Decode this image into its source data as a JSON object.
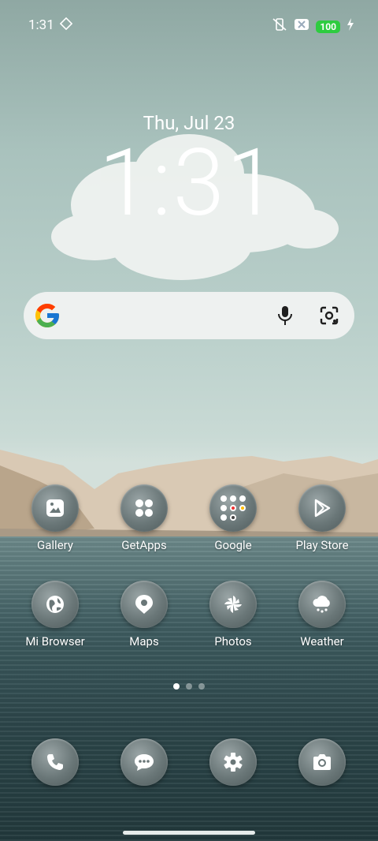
{
  "status_bar": {
    "time": "1:31",
    "battery": "100"
  },
  "lockscreen": {
    "date": "Thu, Jul 23",
    "clock": "1:31"
  },
  "search_bar": {
    "icons": [
      "google-logo",
      "microphone-icon",
      "lens-icon"
    ]
  },
  "apps": [
    {
      "label": "Gallery",
      "icon": "gallery-icon"
    },
    {
      "label": "GetApps",
      "icon": "getapps-icon"
    },
    {
      "label": "Google",
      "icon": "google-folder"
    },
    {
      "label": "Play Store",
      "icon": "play-store-icon"
    },
    {
      "label": "Mi Browser",
      "icon": "globe-icon"
    },
    {
      "label": "Maps",
      "icon": "maps-icon"
    },
    {
      "label": "Photos",
      "icon": "photos-icon"
    },
    {
      "label": "Weather",
      "icon": "weather-icon"
    }
  ],
  "dock": [
    {
      "icon": "phone-icon"
    },
    {
      "icon": "messages-icon"
    },
    {
      "icon": "settings-icon"
    },
    {
      "icon": "camera-icon"
    }
  ],
  "page_indicator": {
    "pages": 3,
    "active": 0
  }
}
